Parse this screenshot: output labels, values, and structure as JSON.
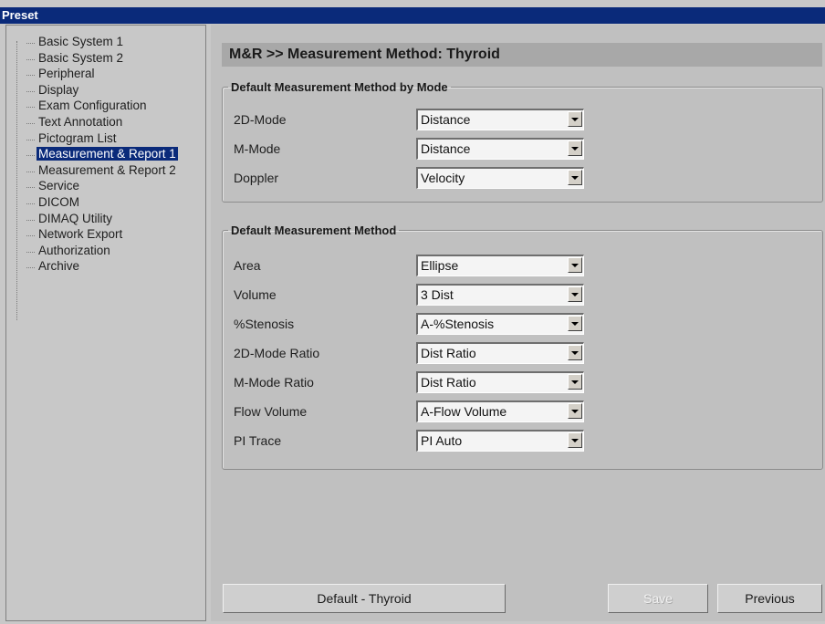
{
  "window": {
    "title": "Preset"
  },
  "sidebar": {
    "items": [
      {
        "label": "Basic System 1",
        "selected": false
      },
      {
        "label": "Basic System 2",
        "selected": false
      },
      {
        "label": "Peripheral",
        "selected": false
      },
      {
        "label": "Display",
        "selected": false
      },
      {
        "label": "Exam Configuration",
        "selected": false
      },
      {
        "label": "Text Annotation",
        "selected": false
      },
      {
        "label": "Pictogram List",
        "selected": false
      },
      {
        "label": "Measurement & Report 1",
        "selected": true
      },
      {
        "label": "Measurement & Report 2",
        "selected": false
      },
      {
        "label": "Service",
        "selected": false
      },
      {
        "label": "DICOM",
        "selected": false
      },
      {
        "label": "DIMAQ Utility",
        "selected": false
      },
      {
        "label": "Network Export",
        "selected": false
      },
      {
        "label": "Authorization",
        "selected": false
      },
      {
        "label": "Archive",
        "selected": false
      }
    ]
  },
  "main": {
    "header": "M&R >> Measurement Method: Thyroid",
    "group_by_mode": {
      "title": "Default Measurement Method by Mode",
      "rows": [
        {
          "label": "2D-Mode",
          "value": "Distance"
        },
        {
          "label": "M-Mode",
          "value": "Distance"
        },
        {
          "label": "Doppler",
          "value": "Velocity"
        }
      ]
    },
    "group_method": {
      "title": "Default Measurement Method",
      "rows": [
        {
          "label": "Area",
          "value": "Ellipse"
        },
        {
          "label": "Volume",
          "value": "3 Dist"
        },
        {
          "label": "%Stenosis",
          "value": "A-%Stenosis"
        },
        {
          "label": "2D-Mode Ratio",
          "value": "Dist Ratio"
        },
        {
          "label": "M-Mode Ratio",
          "value": "Dist Ratio"
        },
        {
          "label": "Flow Volume",
          "value": "A-Flow Volume"
        },
        {
          "label": "PI Trace",
          "value": "PI Auto"
        }
      ]
    }
  },
  "footer": {
    "default_label": "Default - Thyroid",
    "save_label": "Save",
    "previous_label": "Previous"
  },
  "icons": {
    "dropdown": "chevron-down-icon"
  },
  "colors": {
    "titlebar": "#0a2a7a",
    "selection": "#0a2a7a",
    "panel": "#c0c0c0"
  }
}
